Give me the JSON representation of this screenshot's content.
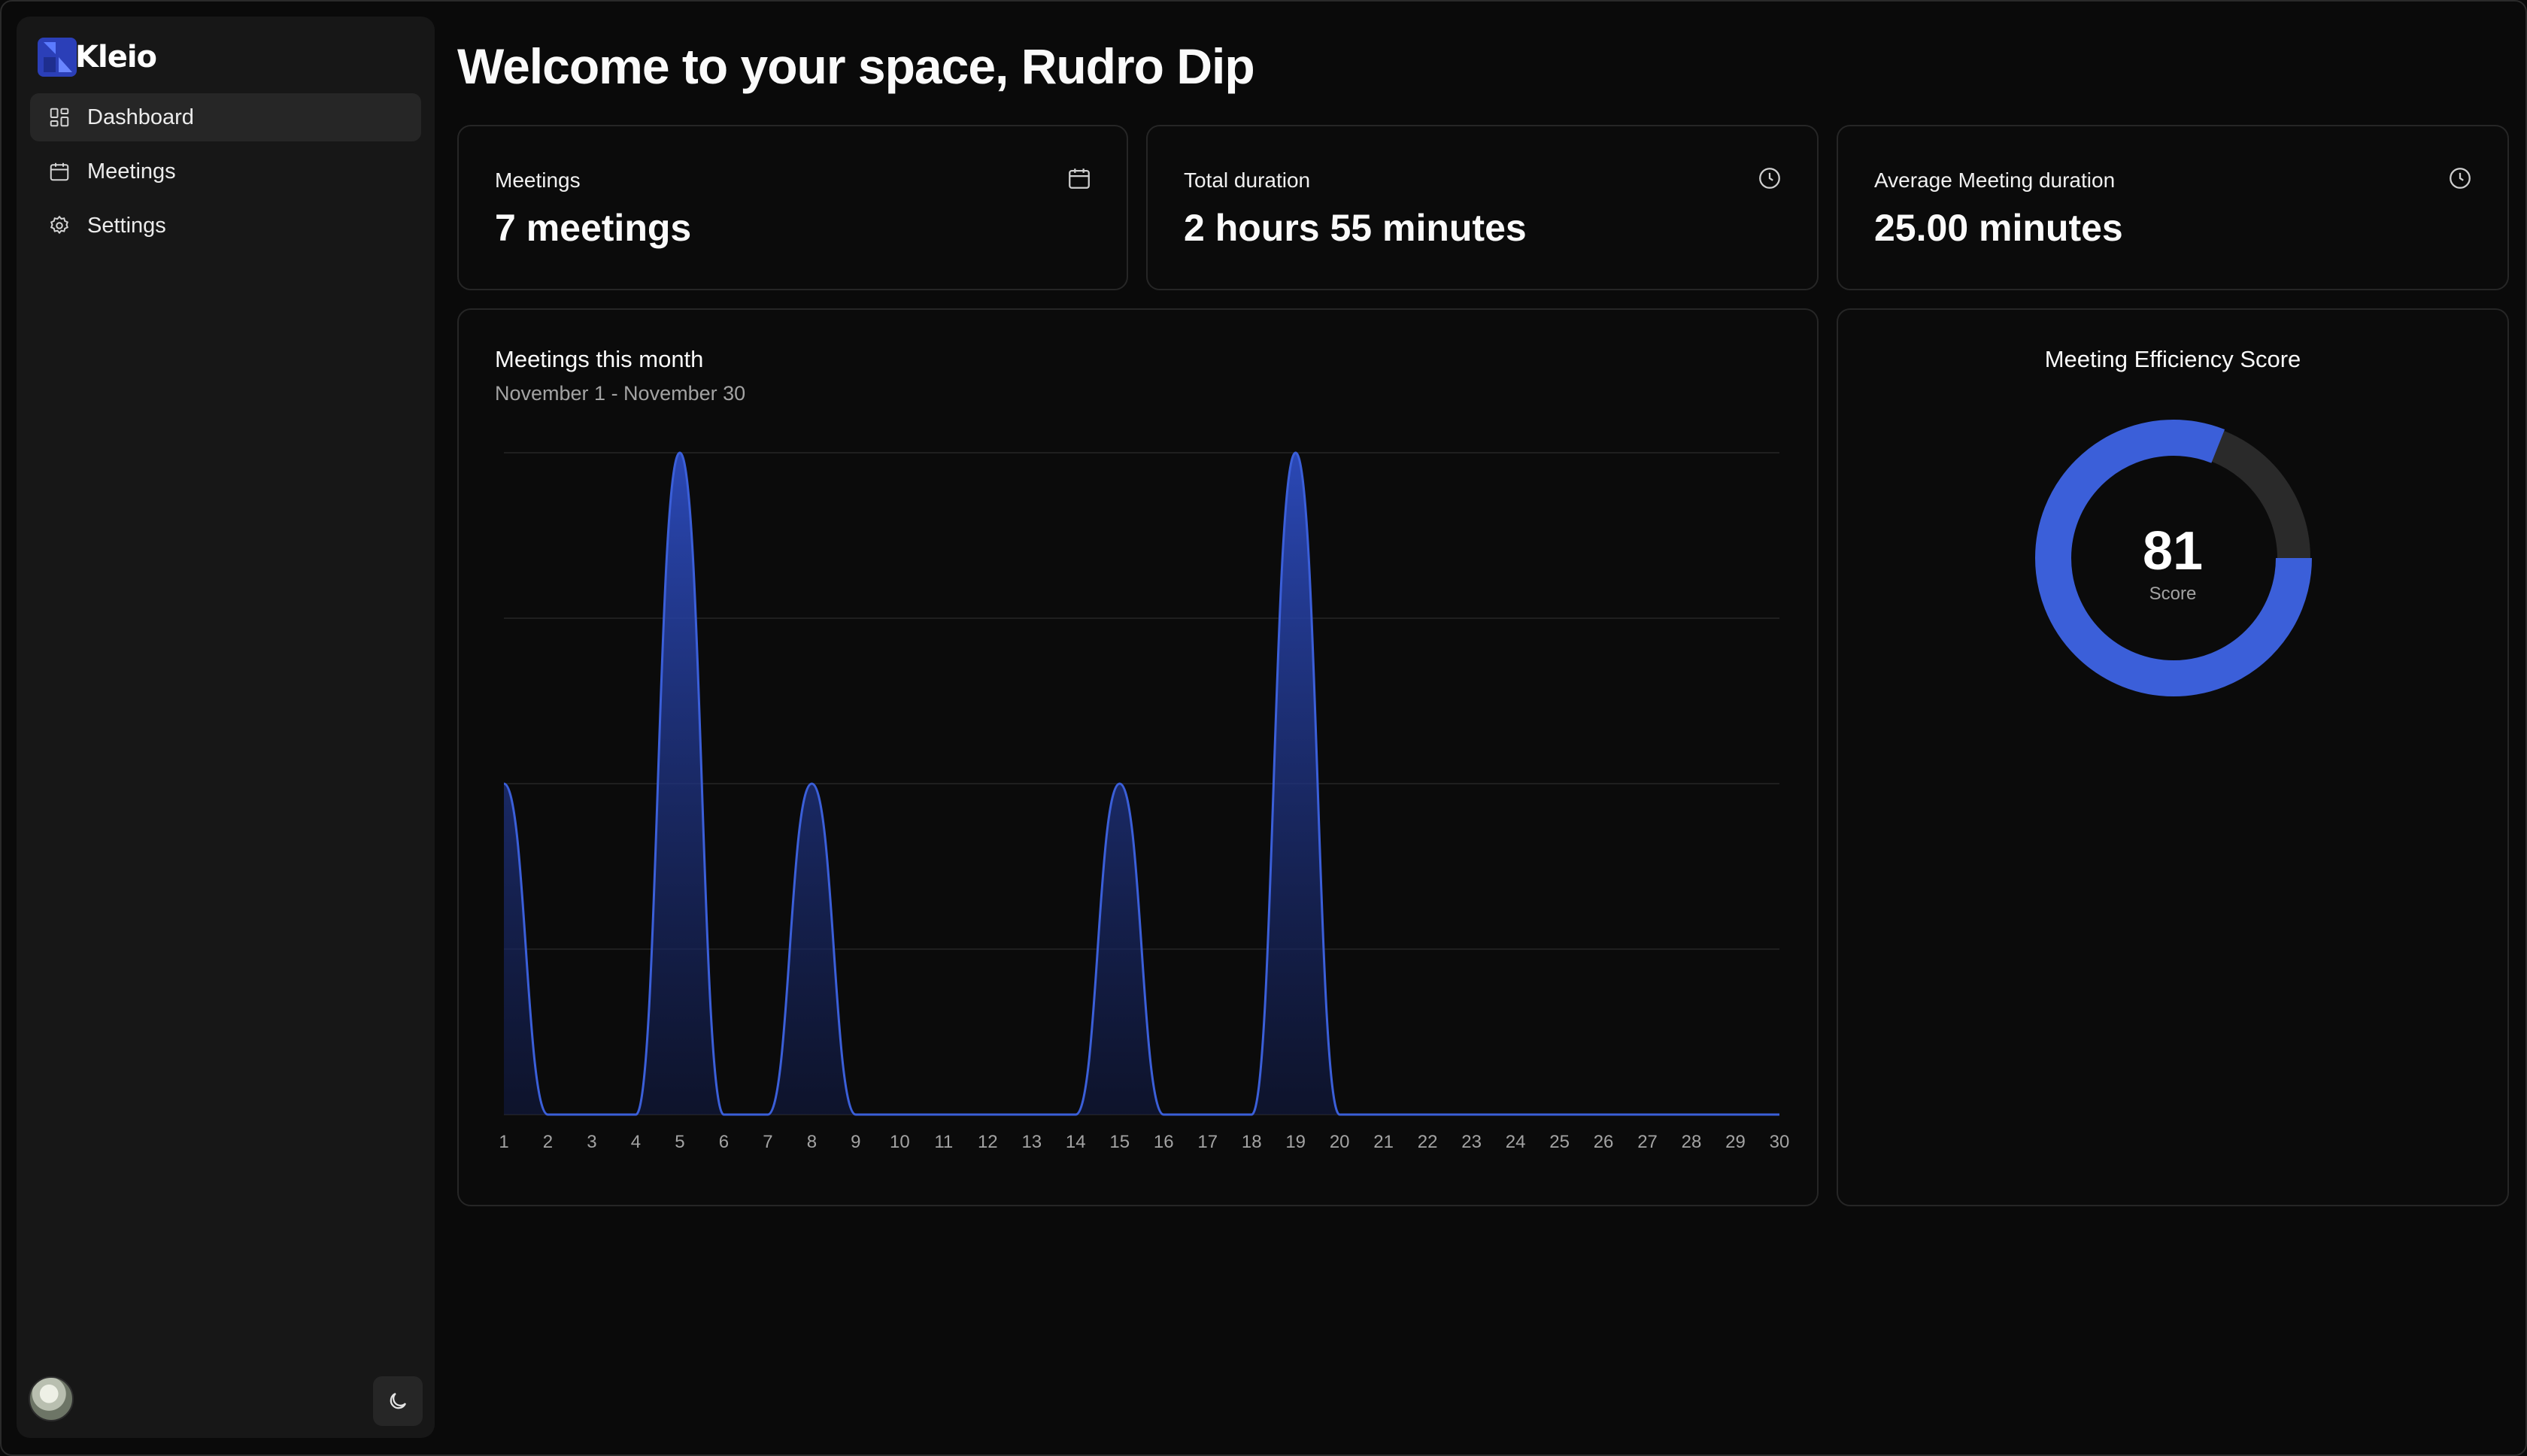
{
  "app": {
    "name": "Kleio"
  },
  "sidebar": {
    "items": [
      {
        "label": "Dashboard",
        "icon": "dashboard-icon",
        "active": true
      },
      {
        "label": "Meetings",
        "icon": "calendar-icon",
        "active": false
      },
      {
        "label": "Settings",
        "icon": "gear-icon",
        "active": false
      }
    ],
    "theme_icon": "moon-icon"
  },
  "page": {
    "title": "Welcome to your space, Rudro Dip"
  },
  "stats": [
    {
      "label": "Meetings",
      "value": "7 meetings",
      "icon": "calendar-icon"
    },
    {
      "label": "Total duration",
      "value": "2 hours 55 minutes",
      "icon": "clock-icon"
    },
    {
      "label": "Average Meeting duration",
      "value": "25.00 minutes",
      "icon": "clock-icon"
    }
  ],
  "meetings_chart": {
    "title": "Meetings this month",
    "subtitle": "November 1 - November 30"
  },
  "efficiency": {
    "title": "Meeting Efficiency Score",
    "score": "81",
    "caption": "Score",
    "score_fraction": 0.81
  },
  "colors": {
    "accent": "#3b5fd9",
    "background": "#0a0a0a",
    "card": "#0b0b0b",
    "sidebar": "#171717"
  },
  "chart_data": {
    "type": "area",
    "x": [
      1,
      2,
      3,
      4,
      5,
      6,
      7,
      8,
      9,
      10,
      11,
      12,
      13,
      14,
      15,
      16,
      17,
      18,
      19,
      20,
      21,
      22,
      23,
      24,
      25,
      26,
      27,
      28,
      29,
      30
    ],
    "tick_labels": [
      "1",
      "2",
      "3",
      "4",
      "5",
      "6",
      "7",
      "8",
      "9",
      "10",
      "11",
      "12",
      "13",
      "14",
      "15",
      "16",
      "17",
      "18",
      "19",
      "20",
      "21",
      "22",
      "23",
      "24",
      "25",
      "26",
      "27",
      "28",
      "29",
      "30"
    ],
    "values": [
      1,
      0,
      0,
      0,
      2,
      0,
      0,
      1,
      0,
      0,
      0,
      0,
      0,
      0,
      1,
      0,
      0,
      0,
      2,
      0,
      0,
      0,
      0,
      0,
      0,
      0,
      0,
      0,
      0,
      0
    ],
    "ylim": [
      0,
      2
    ],
    "grid": true,
    "title": "Meetings this month",
    "xlabel": "",
    "ylabel": ""
  }
}
